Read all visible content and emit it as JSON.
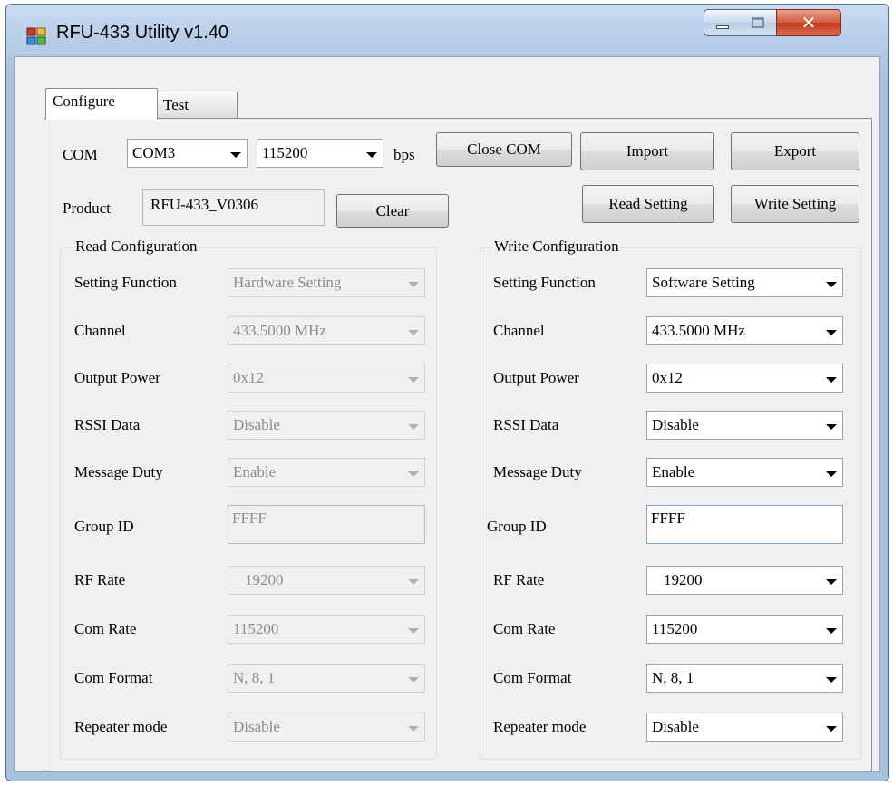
{
  "window": {
    "title": "RFU-433 Utility v1.40"
  },
  "tabs": [
    {
      "label": "Configure"
    },
    {
      "label": "Test"
    }
  ],
  "com": {
    "label": "COM",
    "port": "COM3",
    "baud": "115200",
    "unit": "bps",
    "close_button": "Close COM",
    "import_button": "Import",
    "export_button": "Export"
  },
  "product": {
    "label": "Product",
    "value": "RFU-433_V0306",
    "clear_button": "Clear",
    "read_button": "Read Setting",
    "write_button": "Write Setting"
  },
  "read_config": {
    "title": "Read Configuration",
    "rows": [
      {
        "label": "Setting Function",
        "value": "Hardware Setting"
      },
      {
        "label": "Channel",
        "value": "433.5000 MHz"
      },
      {
        "label": "Output Power",
        "value": "0x12"
      },
      {
        "label": "RSSI Data",
        "value": "Disable"
      },
      {
        "label": "Message Duty",
        "value": "Enable"
      },
      {
        "label": "Group ID",
        "value": "FFFF"
      },
      {
        "label": "RF Rate",
        "value": "19200"
      },
      {
        "label": "Com Rate",
        "value": "115200"
      },
      {
        "label": "Com Format",
        "value": "N, 8, 1"
      },
      {
        "label": "Repeater mode",
        "value": "Disable"
      }
    ]
  },
  "write_config": {
    "title": "Write Configuration",
    "rows": [
      {
        "label": "Setting Function",
        "value": "Software Setting"
      },
      {
        "label": "Channel",
        "value": "433.5000 MHz"
      },
      {
        "label": "Output Power",
        "value": "0x12"
      },
      {
        "label": "RSSI Data",
        "value": "Disable"
      },
      {
        "label": "Message Duty",
        "value": "Enable"
      },
      {
        "label": "Group ID",
        "value": "FFFF"
      },
      {
        "label": "RF Rate",
        "value": "19200"
      },
      {
        "label": "Com Rate",
        "value": "115200"
      },
      {
        "label": "Com Format",
        "value": "N, 8, 1"
      },
      {
        "label": "Repeater mode",
        "value": "Disable"
      }
    ]
  },
  "icons": {
    "app": "app-window-icon",
    "minimize": "minimize-icon",
    "maximize": "maximize-icon",
    "close": "close-icon",
    "dropdown": "chevron-down-icon"
  },
  "colors": {
    "title_bar": "#b7cde7",
    "close_button": "#c23a1c",
    "client_bg": "#f0f0f0"
  }
}
